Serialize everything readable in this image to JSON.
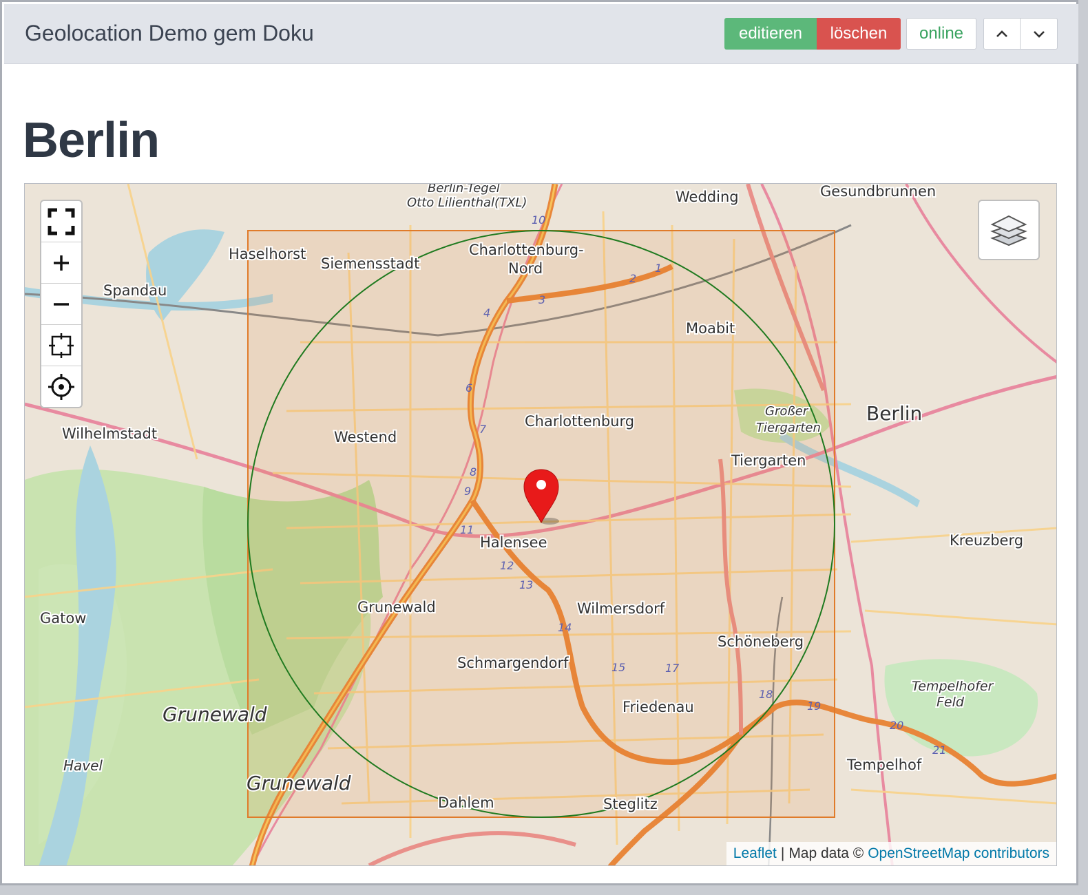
{
  "header": {
    "title": "Geolocation Demo gem Doku",
    "edit_label": "editieren",
    "delete_label": "löschen",
    "online_label": "online"
  },
  "content": {
    "heading": "Berlin"
  },
  "map": {
    "controls": [
      "fullscreen-icon",
      "zoom-in-icon",
      "zoom-out-icon",
      "fit-bounds-icon",
      "locate-icon"
    ],
    "layers_icon": "layers-icon",
    "attribution": {
      "leaflet": "Leaflet",
      "separator": "|",
      "text": "Map data ©",
      "osm": "OpenStreetMap contributors"
    },
    "place_labels": [
      "Berlin-Tegel",
      "Otto Lilienthal(TXL)",
      "Wedding",
      "Gesundbrunnen",
      "Haselhorst",
      "Siemensstadt",
      "Charlottenburg-",
      "Nord",
      "Spandau",
      "Moabit",
      "Berlin",
      "Großer",
      "Tiergarten",
      "Charlottenburg",
      "Westend",
      "Wilhelmstadt",
      "Tiergarten",
      "Halensee",
      "Kreuzberg",
      "Grunewald",
      "Gatow",
      "Wilmersdorf",
      "Schöneberg",
      "Schmargendorf",
      "Tempelhofer",
      "Feld",
      "Friedenau",
      "Grunewald",
      "Havel",
      "Grunewald",
      "Tempelhof",
      "Dahlem",
      "Steglitz"
    ],
    "road_numbers": [
      "10",
      "1",
      "2",
      "3",
      "4",
      "6",
      "7",
      "8",
      "9",
      "11",
      "12",
      "13",
      "14",
      "15",
      "17",
      "18",
      "19",
      "20",
      "21"
    ],
    "colors": {
      "circle": "#1f7a1f",
      "bounds_rect": "#e07b2a",
      "marker": "#e81a1a"
    }
  }
}
